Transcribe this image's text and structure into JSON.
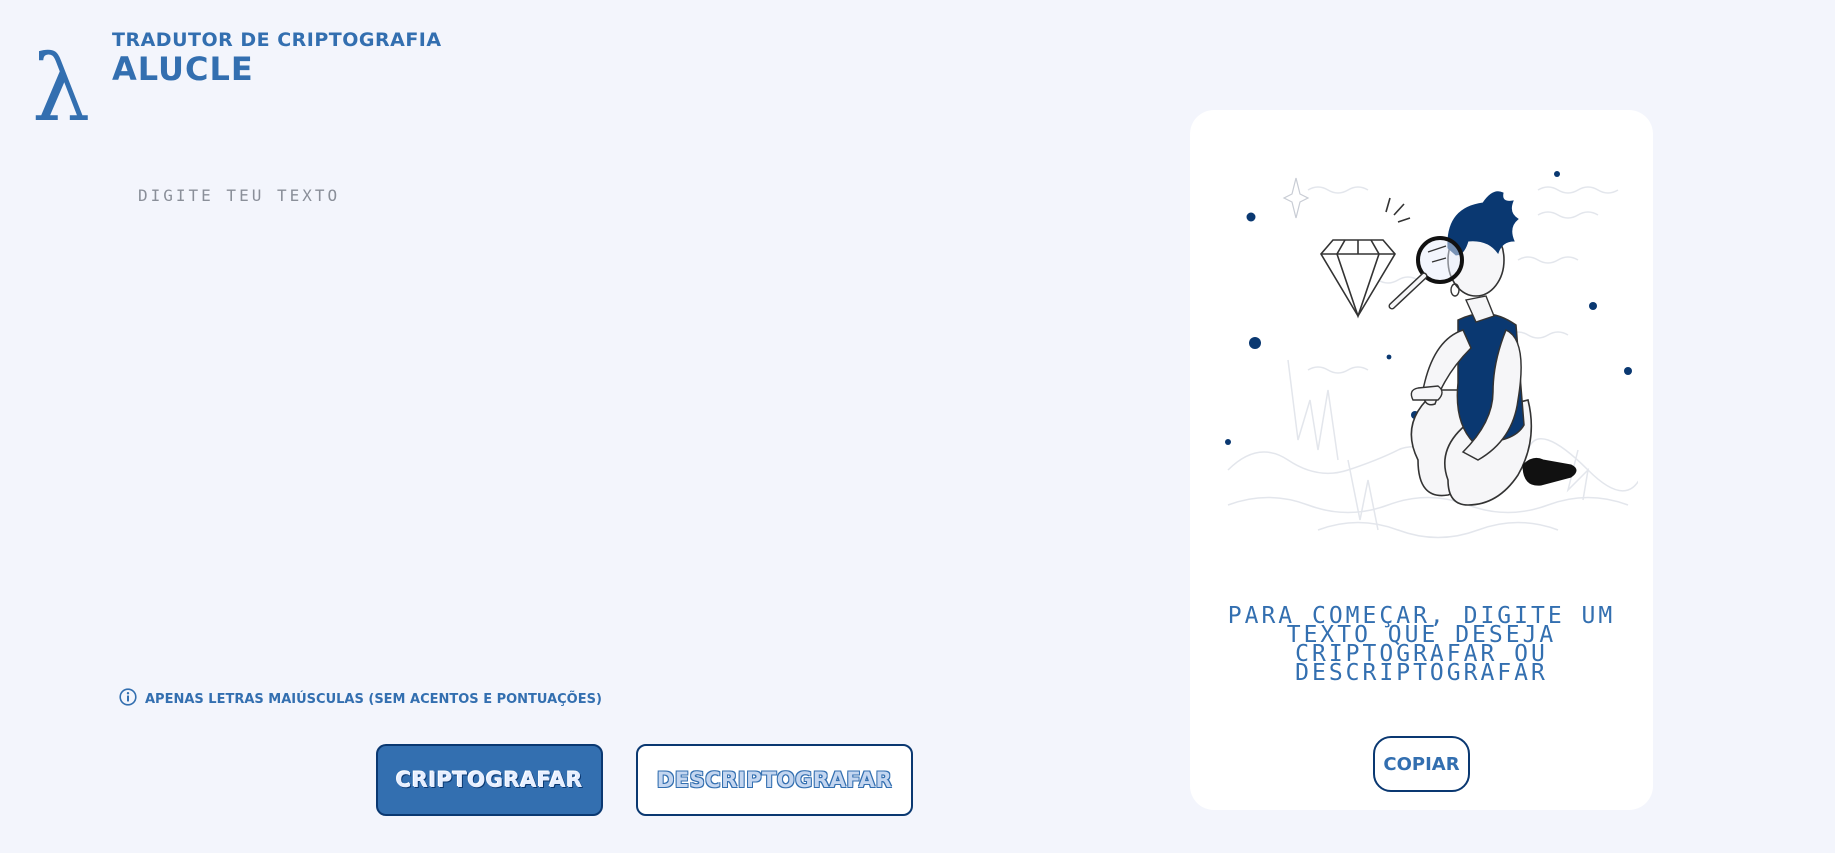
{
  "header": {
    "logo_symbol": "λ",
    "subtitle": "TRADUTOR DE CRIPTOGRAFIA",
    "title": "ALUCLE"
  },
  "editor": {
    "placeholder": "DIGITE TEU TEXTO",
    "value": ""
  },
  "hint": {
    "icon": "info-icon",
    "text": "APENAS LETRAS MAIÚSCULAS (SEM ACENTOS E PONTUAÇÕES)"
  },
  "actions": {
    "encrypt_label": "CRIPTOGRAFAR",
    "decrypt_label": "DESCRIPTOGRAFAR"
  },
  "output_panel": {
    "illustration": "person-with-magnifying-glass-and-diamond",
    "message": "PARA COMEÇAR, DIGITE UM TEXTO QUE DESEJA CRIPTOGRAFAR OU DESCRIPTOGRAFAR",
    "copy_label": "COPIAR"
  },
  "colors": {
    "background": "#f3f5fc",
    "primary": "#336fb0",
    "dark": "#0a3871",
    "panel": "#ffffff"
  }
}
